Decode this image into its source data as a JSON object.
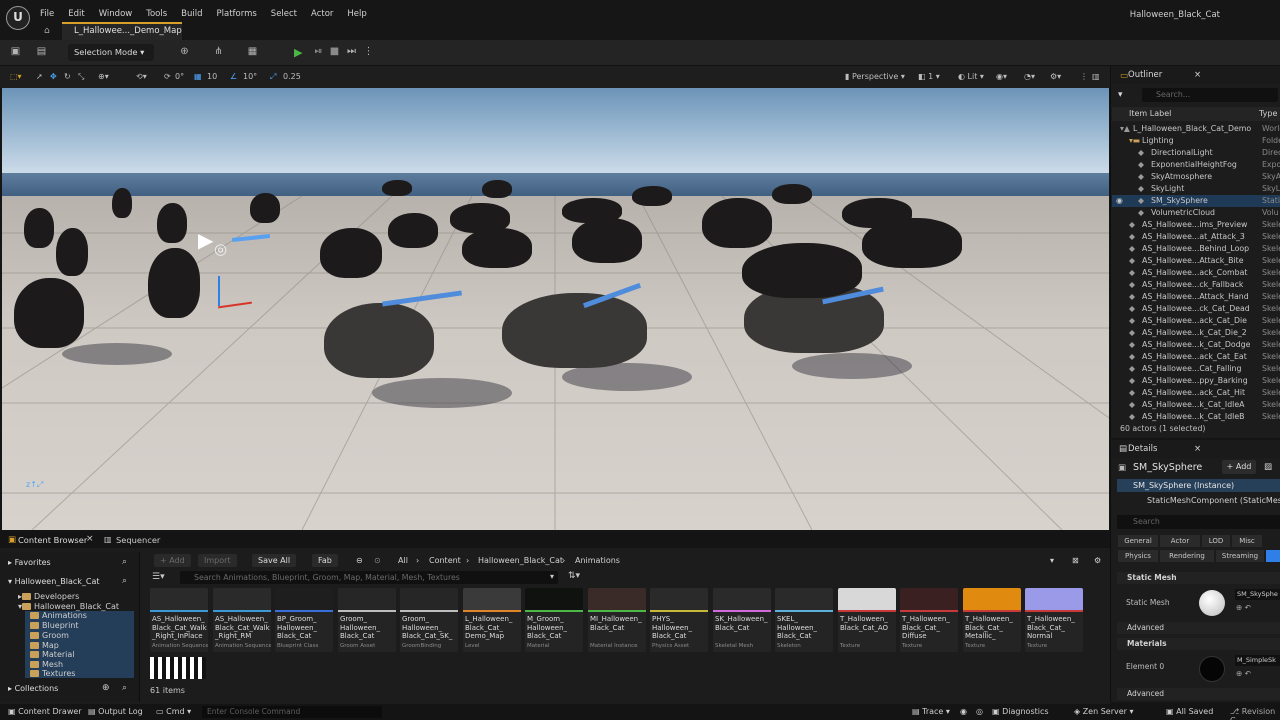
{
  "app": {
    "logo_text": "U",
    "menu": [
      "File",
      "Edit",
      "Window",
      "Tools",
      "Build",
      "Platforms",
      "Select",
      "Actor",
      "Help"
    ],
    "window_title": "Halloween_Black_Cat",
    "level_tab": "L_Hallowee..._Demo_Map"
  },
  "toolbar": {
    "selection_mode": "Selection Mode"
  },
  "viewport_bar": {
    "rotate_snap": "0°",
    "grid_snap": "10",
    "angle_snap": "10°",
    "scale_snap": "0.25",
    "view_mode": "Perspective",
    "camera_speed": "1",
    "lit_mode": "Lit"
  },
  "outliner": {
    "tab": "Outliner",
    "search_placeholder": "Search...",
    "col_label": "Item Label",
    "col_type": "Type",
    "rows": [
      {
        "label": "L_Halloween_Black_Cat_Demo",
        "type": "World",
        "indent": 1
      },
      {
        "label": "Lighting",
        "type": "Folder",
        "indent": 2
      },
      {
        "label": "DirectionalLight",
        "type": "Direc",
        "indent": 3
      },
      {
        "label": "ExponentialHeightFog",
        "type": "Expo",
        "indent": 3
      },
      {
        "label": "SkyAtmosphere",
        "type": "SkyA",
        "indent": 3
      },
      {
        "label": "SkyLight",
        "type": "SkyL",
        "indent": 3
      },
      {
        "label": "SM_SkySphere",
        "type": "Stati",
        "indent": 3,
        "selected": true
      },
      {
        "label": "VolumetricCloud",
        "type": "Volu",
        "indent": 3
      },
      {
        "label": "AS_Hallowee...ims_Preview",
        "type": "Skele",
        "indent": 2
      },
      {
        "label": "AS_Hallowee...at_Attack_3",
        "type": "Skele",
        "indent": 2
      },
      {
        "label": "AS_Hallowee...Behind_Loop",
        "type": "Skele",
        "indent": 2
      },
      {
        "label": "AS_Hallowee...Attack_Bite",
        "type": "Skele",
        "indent": 2
      },
      {
        "label": "AS_Hallowee...ack_Combat",
        "type": "Skele",
        "indent": 2
      },
      {
        "label": "AS_Hallowee...ck_Fallback",
        "type": "Skele",
        "indent": 2
      },
      {
        "label": "AS_Hallowee...Attack_Hand",
        "type": "Skele",
        "indent": 2
      },
      {
        "label": "AS_Hallowee...ck_Cat_Dead",
        "type": "Skele",
        "indent": 2
      },
      {
        "label": "AS_Hallowee...ack_Cat_Die",
        "type": "Skele",
        "indent": 2
      },
      {
        "label": "AS_Hallowee...k_Cat_Die_2",
        "type": "Skele",
        "indent": 2
      },
      {
        "label": "AS_Hallowee...k_Cat_Dodge",
        "type": "Skele",
        "indent": 2
      },
      {
        "label": "AS_Hallowee...ack_Cat_Eat",
        "type": "Skele",
        "indent": 2
      },
      {
        "label": "AS_Hallowee...Cat_Falling",
        "type": "Skele",
        "indent": 2
      },
      {
        "label": "AS_Hallowee...ppy_Barking",
        "type": "Skele",
        "indent": 2
      },
      {
        "label": "AS_Hallowee...ack_Cat_Hit",
        "type": "Skele",
        "indent": 2
      },
      {
        "label": "AS_Hallowee...k_Cat_IdleA",
        "type": "Skele",
        "indent": 2
      },
      {
        "label": "AS_Hallowee...k_Cat_IdleB",
        "type": "Skele",
        "indent": 2
      }
    ],
    "footer": "60 actors (1 selected)"
  },
  "details": {
    "tab": "Details",
    "actor_name": "SM_SkySphere",
    "add_label": "+ Add",
    "instance_label": "SM_SkySphere (Instance)",
    "component_label": "StaticMeshComponent (StaticMeshC",
    "search_placeholder": "Search",
    "filter_row1": [
      "General",
      "Actor",
      "LOD",
      "Misc"
    ],
    "filter_row2": [
      "Physics",
      "Rendering",
      "Streaming"
    ],
    "section_static_mesh": "Static Mesh",
    "prop_static_mesh": "Static Mesh",
    "prop_static_mesh_value": "SM_SkySphe",
    "advanced_1": "Advanced",
    "section_materials": "Materials",
    "prop_element0": "Element 0",
    "prop_element0_value": "M_SimpleSk",
    "advanced_2": "Advanced"
  },
  "content_browser": {
    "tab": "Content Browser",
    "tab2": "Sequencer",
    "add_label": "+ Add",
    "import_label": "Import",
    "save_all_label": "Save All",
    "fab_label": "Fab",
    "breadcrumb": [
      "All",
      "Content",
      "Halloween_Black_Cat",
      "Animations"
    ],
    "search_placeholder": "Search Animations, Blueprint, Groom, Map, Material, Mesh, Textures",
    "favorites": "Favorites",
    "root_folder": "Halloween_Black_Cat",
    "folders": [
      "Developers",
      "Halloween_Black_Cat",
      "Animations",
      "Blueprint",
      "Groom",
      "Map",
      "Material",
      "Mesh",
      "Textures"
    ],
    "collections": "Collections",
    "items_count": "61 items",
    "assets": [
      {
        "name": "AS_Halloween_\nBlack_Cat_Walk\n_Right_InPlace",
        "type": "Animation Sequence",
        "color": "#3b9ad6",
        "thumb": "#2a2a2a"
      },
      {
        "name": "AS_Halloween_\nBlack_Cat_Walk\n_Right_RM",
        "type": "Animation Sequence",
        "color": "#3b9ad6",
        "thumb": "#2a2a2a"
      },
      {
        "name": "BP_Groom_\nHalloween_\nBlack_Cat",
        "type": "Blueprint Class",
        "color": "#3a6ed8",
        "thumb": "#1e1e1e"
      },
      {
        "name": "Groom_\nHalloween_\nBlack_Cat",
        "type": "Groom Asset",
        "color": "#bdbdbd",
        "thumb": "#262626"
      },
      {
        "name": "Groom_\nHalloween_\nBlack_Cat_SK_",
        "type": "GroomBinding",
        "color": "#bdbdbd",
        "thumb": "#262626"
      },
      {
        "name": "L_Halloween_\nBlack_Cat_\nDemo_Map",
        "type": "Level",
        "color": "#e0852a",
        "thumb": "#3a3a3a"
      },
      {
        "name": "M_Groom_\nHalloween_\nBlack_Cat",
        "type": "Material",
        "color": "#4cb845",
        "thumb": "#101210"
      },
      {
        "name": "MI_Halloween_\nBlack_Cat",
        "type": "Material Instance",
        "color": "#4cb845",
        "thumb": "#3a2a28"
      },
      {
        "name": "PHYS_\nHalloween_\nBlack_Cat",
        "type": "Physics Asset",
        "color": "#c8b83a",
        "thumb": "#2a2a2a"
      },
      {
        "name": "SK_Halloween_\nBlack_Cat",
        "type": "Skeletal Mesh",
        "color": "#d06ad8",
        "thumb": "#2a2a2a"
      },
      {
        "name": "SKEL_\nHalloween_\nBlack_Cat",
        "type": "Skeleton",
        "color": "#5ab0d8",
        "thumb": "#2a2a2a"
      },
      {
        "name": "T_Halloween_\nBlack_Cat_AO",
        "type": "Texture",
        "color": "#c83a3a",
        "thumb": "#d8d8d8"
      },
      {
        "name": "T_Halloween_\nBlack_Cat_\nDiffuse",
        "type": "Texture",
        "color": "#c83a3a",
        "thumb": "#3a2020"
      },
      {
        "name": "T_Halloween_\nBlack_Cat_\nMetallic_",
        "type": "Texture",
        "color": "#c83a3a",
        "thumb": "#e08a10"
      },
      {
        "name": "T_Halloween_\nBlack_Cat_\nNormal",
        "type": "Texture",
        "color": "#c83a3a",
        "thumb": "#9a9ae8"
      }
    ]
  },
  "statusbar": {
    "content_drawer": "Content Drawer",
    "output_log": "Output Log",
    "cmd": "Cmd",
    "console_placeholder": "Enter Console Command",
    "trace": "Trace",
    "diagnostics": "Diagnostics",
    "zen_server": "Zen Server",
    "all_saved": "All Saved",
    "revision_control": "Revision C"
  }
}
